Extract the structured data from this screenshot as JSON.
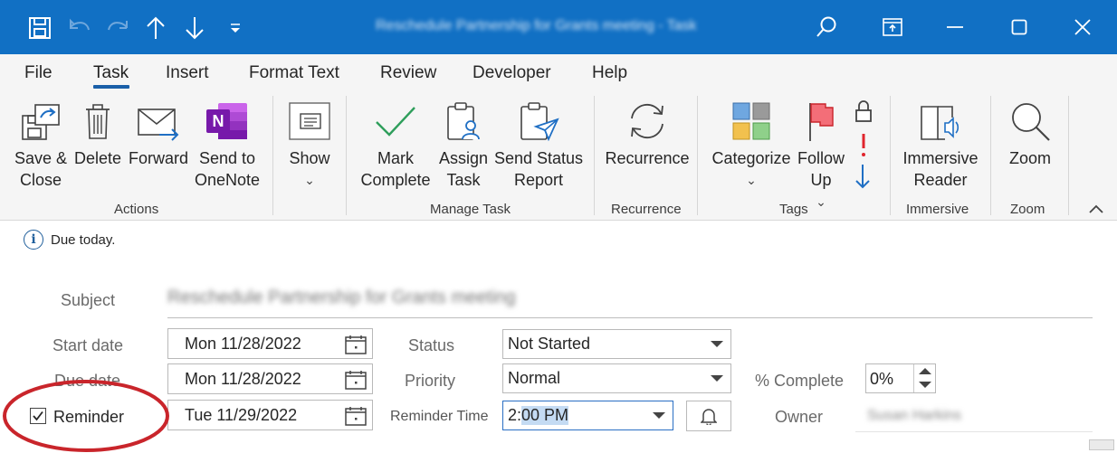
{
  "window": {
    "title": "Reschedule Partnership for Grants meeting  -  Task",
    "colors": {
      "titlebar": "#1170c4",
      "ribbon": "#f5f5f5",
      "accent": "#1a5fa8",
      "annotation": "#c9252b"
    },
    "icons": [
      "save-icon",
      "undo-icon",
      "redo-icon",
      "arrow-up-icon",
      "arrow-down-icon",
      "customize-qat-icon",
      "search-icon",
      "ribbon-display-icon",
      "minimize-icon",
      "maximize-icon",
      "close-icon"
    ]
  },
  "menu": {
    "tabs": [
      "File",
      "Task",
      "Insert",
      "Format Text",
      "Review",
      "Developer",
      "Help"
    ],
    "active": "Task"
  },
  "ribbon": {
    "actions": {
      "save_close": "Save &\nClose",
      "delete": "Delete",
      "forward": "Forward",
      "send_onenote": "Send to\nOneNote",
      "group": "Actions"
    },
    "show": {
      "label": "Show",
      "chevron": "⌄"
    },
    "manage": {
      "mark_complete": "Mark\nComplete",
      "assign_task": "Assign\nTask",
      "send_status": "Send Status\nReport",
      "group": "Manage Task"
    },
    "recurrence": {
      "label": "Recurrence",
      "group": "Recurrence"
    },
    "tags": {
      "categorize": "Categorize",
      "follow_up": "Follow\nUp",
      "chevron": "⌄",
      "group": "Tags"
    },
    "immersive": {
      "label": "Immersive\nReader",
      "group": "Immersive"
    },
    "zoom": {
      "label": "Zoom",
      "group": "Zoom"
    }
  },
  "form": {
    "info": "Due today.",
    "subject_label": "Subject",
    "subject_value": "Reschedule Partnership for Grants meeting",
    "start_label": "Start date",
    "start_value": "Mon 11/28/2022",
    "due_label": "Due date",
    "due_value": "Mon 11/28/2022",
    "reminder_label": "Reminder",
    "reminder_checked": true,
    "reminder_check": "✓",
    "reminder_date": "Tue 11/29/2022",
    "status_label": "Status",
    "status_value": "Not Started",
    "priority_label": "Priority",
    "priority_value": "Normal",
    "reminder_time_label": "Reminder Time",
    "reminder_time_prefix": "2:",
    "reminder_time_selected": "00 PM",
    "complete_label": "% Complete",
    "complete_value": "0%",
    "owner_label": "Owner",
    "owner_value": "Susan Harkins"
  }
}
